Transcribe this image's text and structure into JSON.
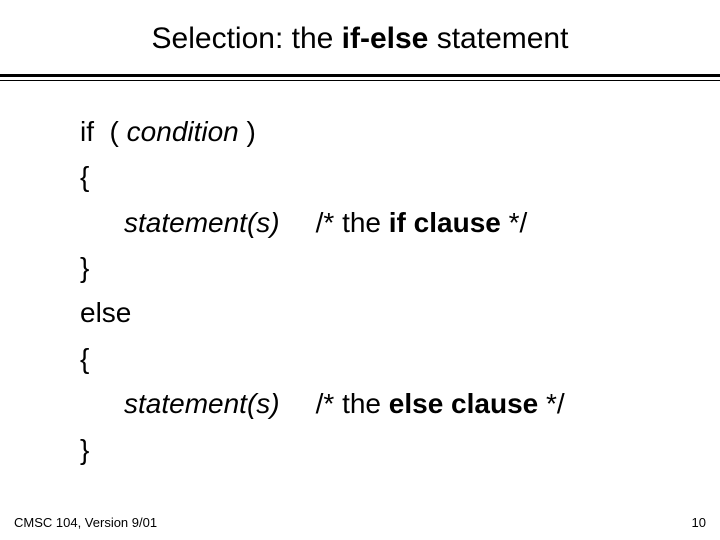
{
  "title": {
    "t1": "Selection:  the ",
    "t2": "if-else",
    "t3": " statement"
  },
  "code": {
    "l1a": "if  ( ",
    "l1b": "condition",
    "l1c": " )",
    "l2": "{",
    "l3a": "statement(s)",
    "l3b": "/* the ",
    "l3c": "if clause",
    "l3d": " */",
    "l4": "}",
    "l5": "else",
    "l6": "{",
    "l7a": "statement(s)",
    "l7b": "/* the ",
    "l7c": "else clause",
    "l7d": " */",
    "l8": "}"
  },
  "footer": {
    "left": "CMSC 104, Version 9/01",
    "right": "10"
  }
}
